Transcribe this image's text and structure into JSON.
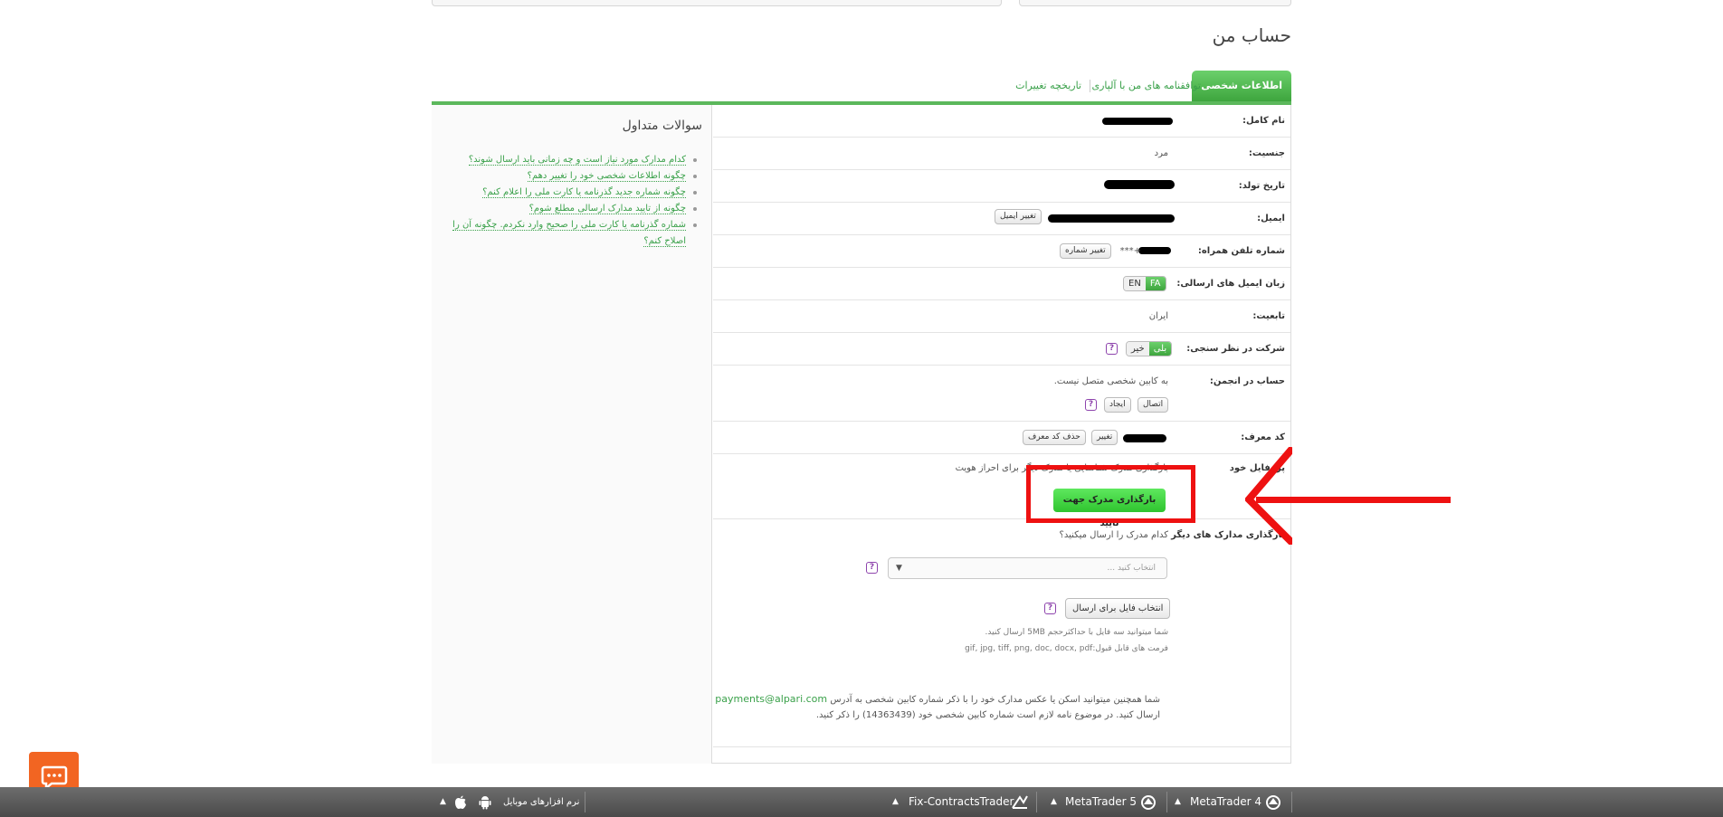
{
  "page_title": "حساب من",
  "tabs": [
    {
      "label": "اطلاعات شخصی",
      "active": true
    },
    {
      "label": "توافقنامه های من با آلپاری",
      "active": false
    },
    {
      "label": "تاریخچه تغییرات",
      "active": false
    }
  ],
  "faq": {
    "title": "سوالات متداول",
    "items": [
      "کدام مدارک مورد نیاز است و چه زمانی باید ارسال شوند؟",
      "چگونه اطلاعات شخصی خود را تغییر دهم؟",
      "چگونه شماره جدید گذرنامه یا کارت ملی را اعلام کنم؟",
      "چگونه از تایید مدارک ارسالی مطلع شوم؟",
      "شماره گذرنامه یا کارت ملی را صحیح وارد نکردم. چگونه آن را اصلاح کنم؟"
    ]
  },
  "profile": {
    "full_name_label": "نام کامل:",
    "gender_label": "جنسیت:",
    "gender_value": "مرد",
    "birthdate_label": "تاریخ تولد:",
    "email_label": "ایمیل:",
    "change_email_button": "تغییر ایمیل",
    "phone_label": "شماره تلفن همراه:",
    "phone_value": "+***",
    "change_phone_button": "تغییر شماره",
    "email_language_label": "زبان ایمیل های ارسالی:",
    "lang_fa": "FA",
    "lang_en": "EN",
    "citizenship_label": "تابعیت:",
    "citizenship_value": "ایران",
    "survey_label": "شرکت در نظر سنجی:",
    "survey_yes": "بلی",
    "survey_no": "خیر",
    "forum_label": "حساب در انجمن:",
    "forum_value": "به کابین شخصی متصل نیست.",
    "forum_connect_button": "اتصال",
    "forum_create_button": "ایجاد",
    "referral_label": "کد معرف:",
    "referral_change_button": "تغییر",
    "referral_delete_button": "حذف کد معرف",
    "profile_label": "پروفایل خود",
    "profile_note": "بارگذاری مدرک شناسایی یا مدرک دیگر برای احراز هویت",
    "upload_button": "بارگذاری مدرک جهت تایید",
    "other_docs_label": "بارگذاری مدارک های دیگر",
    "which_doc_question": "کدام مدرک را ارسال میکنید؟",
    "select_placeholder": "انتخاب کنید ...",
    "choose_file_button": "انتخاب فایل برای ارسال",
    "size_note": "شما میتوانید سه فایل با حداکثرحجم 5MB ارسال کنید.",
    "formats_note": "فرمت های قابل قبول:gif, jpg, tiff, png, doc, docx, pdf",
    "alt_line1": "شما همچنین میتوانید اسکن یا عکس مدارک خود را با ذکر شماره کابین شخصی به آدرس",
    "alt_email": "payments@alpari.com",
    "alt_line2": "ارسال کنید. در موضوع نامه لازم است شماره کابین شخصی خود (14363439) را ذکر کنید."
  },
  "taskbar": {
    "mobile_label": "نرم افزارهای موبایل",
    "fix_label": "Fix-ContractsTrader",
    "mt5_label": "MetaTrader 5",
    "mt4_label": "MetaTrader 4"
  },
  "colors": {
    "accent": "#3ea53e",
    "annotation": "#ee1111",
    "chat": "#f26522"
  }
}
